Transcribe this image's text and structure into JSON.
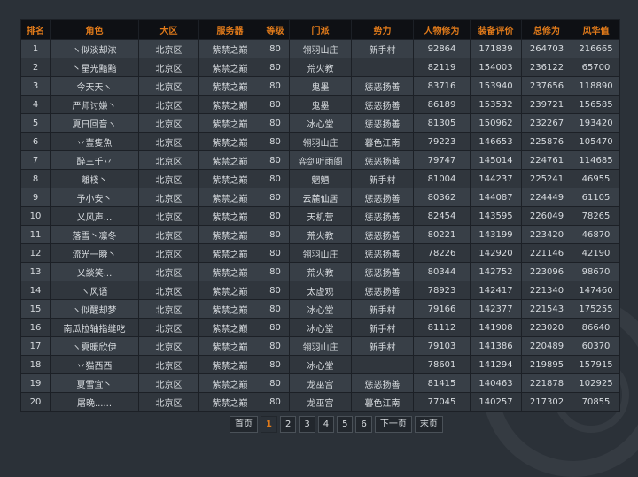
{
  "table": {
    "headers": [
      "排名",
      "角色",
      "大区",
      "服务器",
      "等级",
      "门派",
      "势力",
      "人物修为",
      "装备评价",
      "总修为",
      "风华值"
    ],
    "rows": [
      [
        "1",
        "ヽ似淡却浓",
        "北京区",
        "紫禁之巅",
        "80",
        "翎羽山庄",
        "新手村",
        "92864",
        "171839",
        "264703",
        "216665"
      ],
      [
        "2",
        "丶星光黯黯",
        "北京区",
        "紫禁之巅",
        "80",
        "荒火教",
        "",
        "82119",
        "154003",
        "236122",
        "65700"
      ],
      [
        "3",
        "今天天ヽ",
        "北京区",
        "紫禁之巅",
        "80",
        "鬼墨",
        "惩恶扬善",
        "83716",
        "153940",
        "237656",
        "118890"
      ],
      [
        "4",
        "严师讨嫌丶",
        "北京区",
        "紫禁之巅",
        "80",
        "鬼墨",
        "惩恶扬善",
        "86189",
        "153532",
        "239721",
        "156585"
      ],
      [
        "5",
        "夏日回音ヽ",
        "北京区",
        "紫禁之巅",
        "80",
        "冰心堂",
        "惩恶扬善",
        "81305",
        "150962",
        "232267",
        "193420"
      ],
      [
        "6",
        "丷壹隻魚",
        "北京区",
        "紫禁之巅",
        "80",
        "翎羽山庄",
        "暮色江南",
        "79223",
        "146653",
        "225876",
        "105470"
      ],
      [
        "7",
        "醉三千丷",
        "北京区",
        "紫禁之巅",
        "80",
        "弈剑听雨阁",
        "惩恶扬善",
        "79747",
        "145014",
        "224761",
        "114685"
      ],
      [
        "8",
        "離棧丶",
        "北京区",
        "紫禁之巅",
        "80",
        "魍魉",
        "新手村",
        "81004",
        "144237",
        "225241",
        "46955"
      ],
      [
        "9",
        "予小安丶",
        "北京区",
        "紫禁之巅",
        "80",
        "云麓仙居",
        "惩恶扬善",
        "80362",
        "144087",
        "224449",
        "61105"
      ],
      [
        "10",
        "乂风声...",
        "北京区",
        "紫禁之巅",
        "80",
        "天机营",
        "惩恶扬善",
        "82454",
        "143595",
        "226049",
        "78265"
      ],
      [
        "11",
        "落雪丶凛冬",
        "北京区",
        "紫禁之巅",
        "80",
        "荒火教",
        "惩恶扬善",
        "80221",
        "143199",
        "223420",
        "46870"
      ],
      [
        "12",
        "流光一瞬丶",
        "北京区",
        "紫禁之巅",
        "80",
        "翎羽山庄",
        "惩恶扬善",
        "78226",
        "142920",
        "221146",
        "42190"
      ],
      [
        "13",
        "乂談笑...",
        "北京区",
        "紫禁之巅",
        "80",
        "荒火教",
        "惩恶扬善",
        "80344",
        "142752",
        "223096",
        "98670"
      ],
      [
        "14",
        "ヽ风语",
        "北京区",
        "紫禁之巅",
        "80",
        "太虚观",
        "惩恶扬善",
        "78923",
        "142417",
        "221340",
        "147460"
      ],
      [
        "15",
        "ヽ似醒却梦",
        "北京区",
        "紫禁之巅",
        "80",
        "冰心堂",
        "新手村",
        "79166",
        "142377",
        "221543",
        "175255"
      ],
      [
        "16",
        "南瓜拉轴指缝吃",
        "北京区",
        "紫禁之巅",
        "80",
        "冰心堂",
        "新手村",
        "81112",
        "141908",
        "223020",
        "86640"
      ],
      [
        "17",
        "ヽ夏暖欣伊",
        "北京区",
        "紫禁之巅",
        "80",
        "翎羽山庄",
        "新手村",
        "79103",
        "141386",
        "220489",
        "60370"
      ],
      [
        "18",
        "丷猫西西",
        "北京区",
        "紫禁之巅",
        "80",
        "冰心堂",
        "",
        "78601",
        "141294",
        "219895",
        "157915"
      ],
      [
        "19",
        "夏雪宜丶",
        "北京区",
        "紫禁之巅",
        "80",
        "龙巫宫",
        "惩恶扬善",
        "81415",
        "140463",
        "221878",
        "102925"
      ],
      [
        "20",
        "屠晚......",
        "北京区",
        "紫禁之巅",
        "80",
        "龙巫宫",
        "暮色江南",
        "77045",
        "140257",
        "217302",
        "70855"
      ]
    ]
  },
  "pagination": {
    "first": "首页",
    "pages": [
      "1",
      "2",
      "3",
      "4",
      "5",
      "6"
    ],
    "current": "1",
    "next": "下一页",
    "last": "末页"
  },
  "colors": {
    "header_text": "#e07a1a",
    "header_bg": "#0e1014",
    "row_odd": "#383f47",
    "row_even": "#30363d",
    "page_bg": "#2b3138"
  }
}
